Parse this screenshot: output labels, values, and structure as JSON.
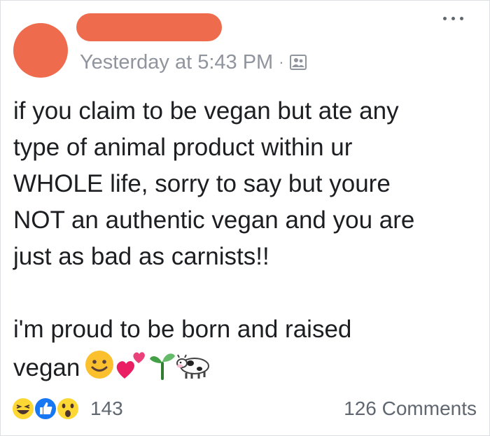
{
  "colors": {
    "redaction": "#ee6c4d",
    "meta_text": "#90949c",
    "body_text": "#1c1e21"
  },
  "post": {
    "timestamp": "Yesterday at 5:43 PM",
    "separator": "·",
    "audience_icon": "friends-icon",
    "paragraph_1": "if you claim to be vegan but ate any\ntype of animal product within ur\nWHOLE life, sorry to say but youre\nNOT an authentic vegan and you are\njust as bad as carnists!!",
    "paragraph_2_line_1": "i'm proud to be born and raised",
    "paragraph_2_line_2": "vegan",
    "emojis": [
      "smiling-face-icon",
      "two-hearts-icon",
      "seedling-icon",
      "cow-icon"
    ]
  },
  "footer": {
    "reaction_icons": [
      "haha-reaction-icon",
      "like-reaction-icon",
      "wow-reaction-icon"
    ],
    "reaction_count": "143",
    "comments_label": "126 Comments"
  }
}
